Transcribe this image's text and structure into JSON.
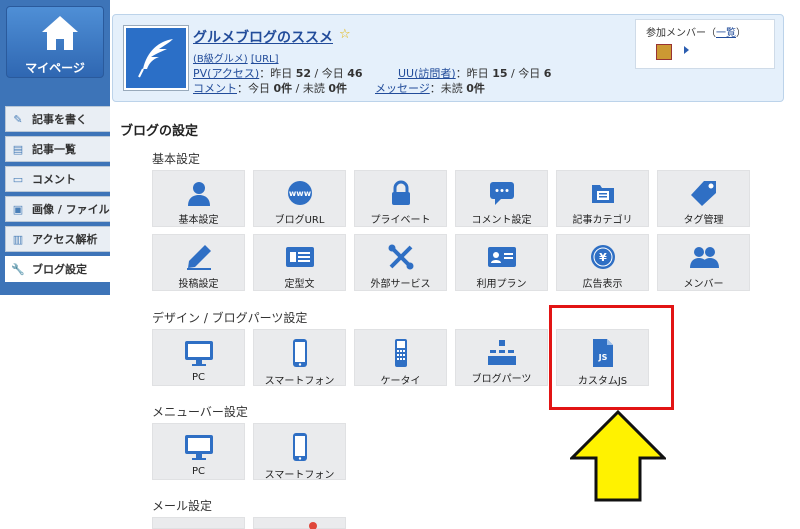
{
  "sidebar": {
    "mypage_label": "マイページ",
    "items": [
      {
        "label": "記事を書く",
        "icon": "pencil-icon"
      },
      {
        "label": "記事一覧",
        "icon": "document-list-icon"
      },
      {
        "label": "コメント",
        "icon": "comment-icon"
      },
      {
        "label": "画像 / ファイル",
        "icon": "image-icon"
      },
      {
        "label": "アクセス解析",
        "icon": "bar-chart-icon"
      },
      {
        "label": "ブログ設定",
        "icon": "wrench-icon"
      }
    ]
  },
  "header": {
    "blog_title": "グルメブログのススメ",
    "category": "(B級グルメ)",
    "url_link": "[URL]",
    "pv_label": "PV(アクセス)",
    "pv_text": "：昨日",
    "pv_yesterday": "52",
    "pv_today_sep": "/ 今日",
    "pv_today": "46",
    "uu_label": "UU(訪問者)",
    "uu_text": "：昨日",
    "uu_yesterday": "15",
    "uu_today_sep": "/ 今日",
    "uu_today": "6",
    "comment_label": "コメント",
    "comment_text": "：今日",
    "comment_today": "0件",
    "comment_unread_sep": "/ 未読",
    "comment_unread": "0件",
    "message_label": "メッセージ",
    "message_text": "：未読",
    "message_unread": "0件",
    "members_label": "参加メンバー",
    "members_paren_open": "（",
    "members_list_link": "一覧",
    "members_paren_close": "）"
  },
  "main": {
    "title": "ブログの設定",
    "sections": {
      "basic": "基本設定",
      "design": "デザイン / ブログパーツ設定",
      "menubar": "メニューバー設定",
      "mail": "メール設定"
    },
    "basic_tiles": [
      {
        "label": "基本設定",
        "icon": "user-icon"
      },
      {
        "label": "ブログURL",
        "icon": "www-globe-icon"
      },
      {
        "label": "プライベート",
        "icon": "lock-icon"
      },
      {
        "label": "コメント設定",
        "icon": "comment-bubble-icon"
      },
      {
        "label": "記事カテゴリ",
        "icon": "folder-icon"
      },
      {
        "label": "タグ管理",
        "icon": "tag-icon"
      },
      {
        "label": "投稿設定",
        "icon": "pencil-icon"
      },
      {
        "label": "定型文",
        "icon": "template-icon"
      },
      {
        "label": "外部サービス",
        "icon": "tools-icon"
      },
      {
        "label": "利用プラン",
        "icon": "id-card-icon"
      },
      {
        "label": "広告表示",
        "icon": "yen-coin-icon"
      },
      {
        "label": "メンバー",
        "icon": "members-icon"
      }
    ],
    "design_tiles": [
      {
        "label": "PC",
        "icon": "monitor-icon"
      },
      {
        "label": "スマートフォン",
        "icon": "smartphone-icon"
      },
      {
        "label": "ケータイ",
        "icon": "feature-phone-icon"
      },
      {
        "label": "ブログパーツ",
        "icon": "blog-parts-icon"
      },
      {
        "label": "カスタムJS",
        "icon": "js-file-icon"
      }
    ],
    "menubar_tiles": [
      {
        "label": "PC",
        "icon": "monitor-icon"
      },
      {
        "label": "スマートフォン",
        "icon": "smartphone-icon"
      }
    ]
  },
  "colors": {
    "accent_blue": "#2f6fc4",
    "highlight_red": "#e21414",
    "arrow_yellow": "#fff200"
  }
}
